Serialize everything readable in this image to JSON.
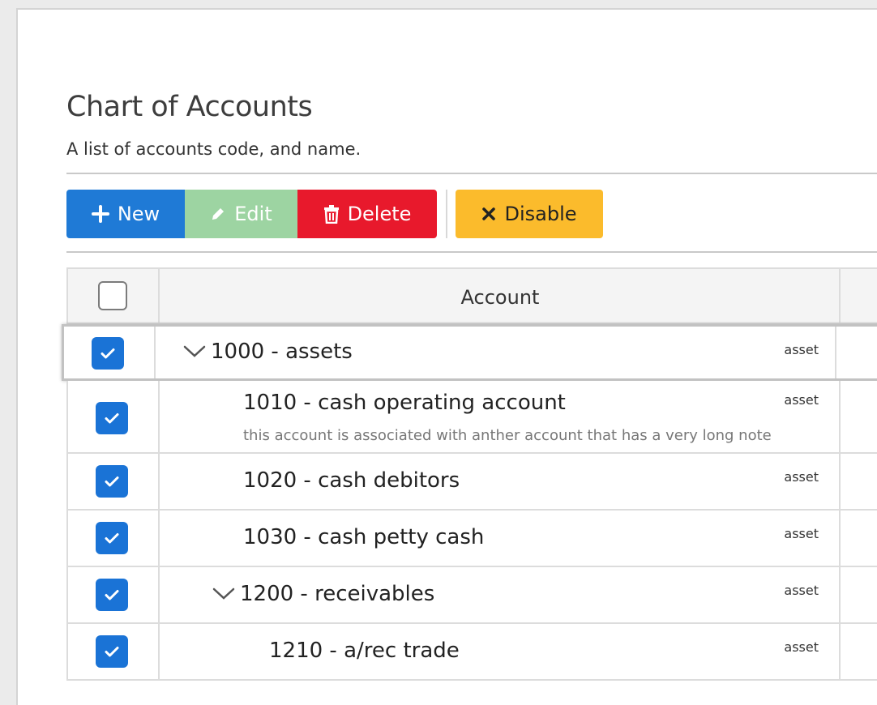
{
  "page": {
    "title": "Chart of Accounts",
    "subtitle": "A list of accounts code, and name."
  },
  "toolbar": {
    "new_label": "New",
    "new_icon": "plus-icon",
    "edit_label": "Edit",
    "edit_icon": "pencil-icon",
    "delete_label": "Delete",
    "delete_icon": "trash-icon",
    "disable_label": "Disable",
    "disable_icon": "x-icon",
    "colors": {
      "new": "#1f7ad6",
      "edit": "#9dd4a2",
      "delete": "#e8192c",
      "disable": "#fbbb2c"
    }
  },
  "table": {
    "header": {
      "account": "Account",
      "select_all_checked": false
    },
    "rows": [
      {
        "code_name": "1000 - assets",
        "type": "asset",
        "note": "",
        "expandable": true,
        "checked": true,
        "selected": true
      },
      {
        "code_name": "1010 - cash operating account",
        "type": "asset",
        "note": "this account is associated with anther account that has a very long note",
        "expandable": false,
        "checked": true,
        "selected": false
      },
      {
        "code_name": "1020 - cash debitors",
        "type": "asset",
        "note": "",
        "expandable": false,
        "checked": true,
        "selected": false
      },
      {
        "code_name": "1030 - cash petty cash",
        "type": "asset",
        "note": "",
        "expandable": false,
        "checked": true,
        "selected": false
      },
      {
        "code_name": "1200 - receivables",
        "type": "asset",
        "note": "",
        "expandable": true,
        "checked": true,
        "selected": false
      },
      {
        "code_name": "1210 - a/rec trade",
        "type": "asset",
        "note": "",
        "expandable": false,
        "checked": true,
        "selected": false
      }
    ]
  }
}
